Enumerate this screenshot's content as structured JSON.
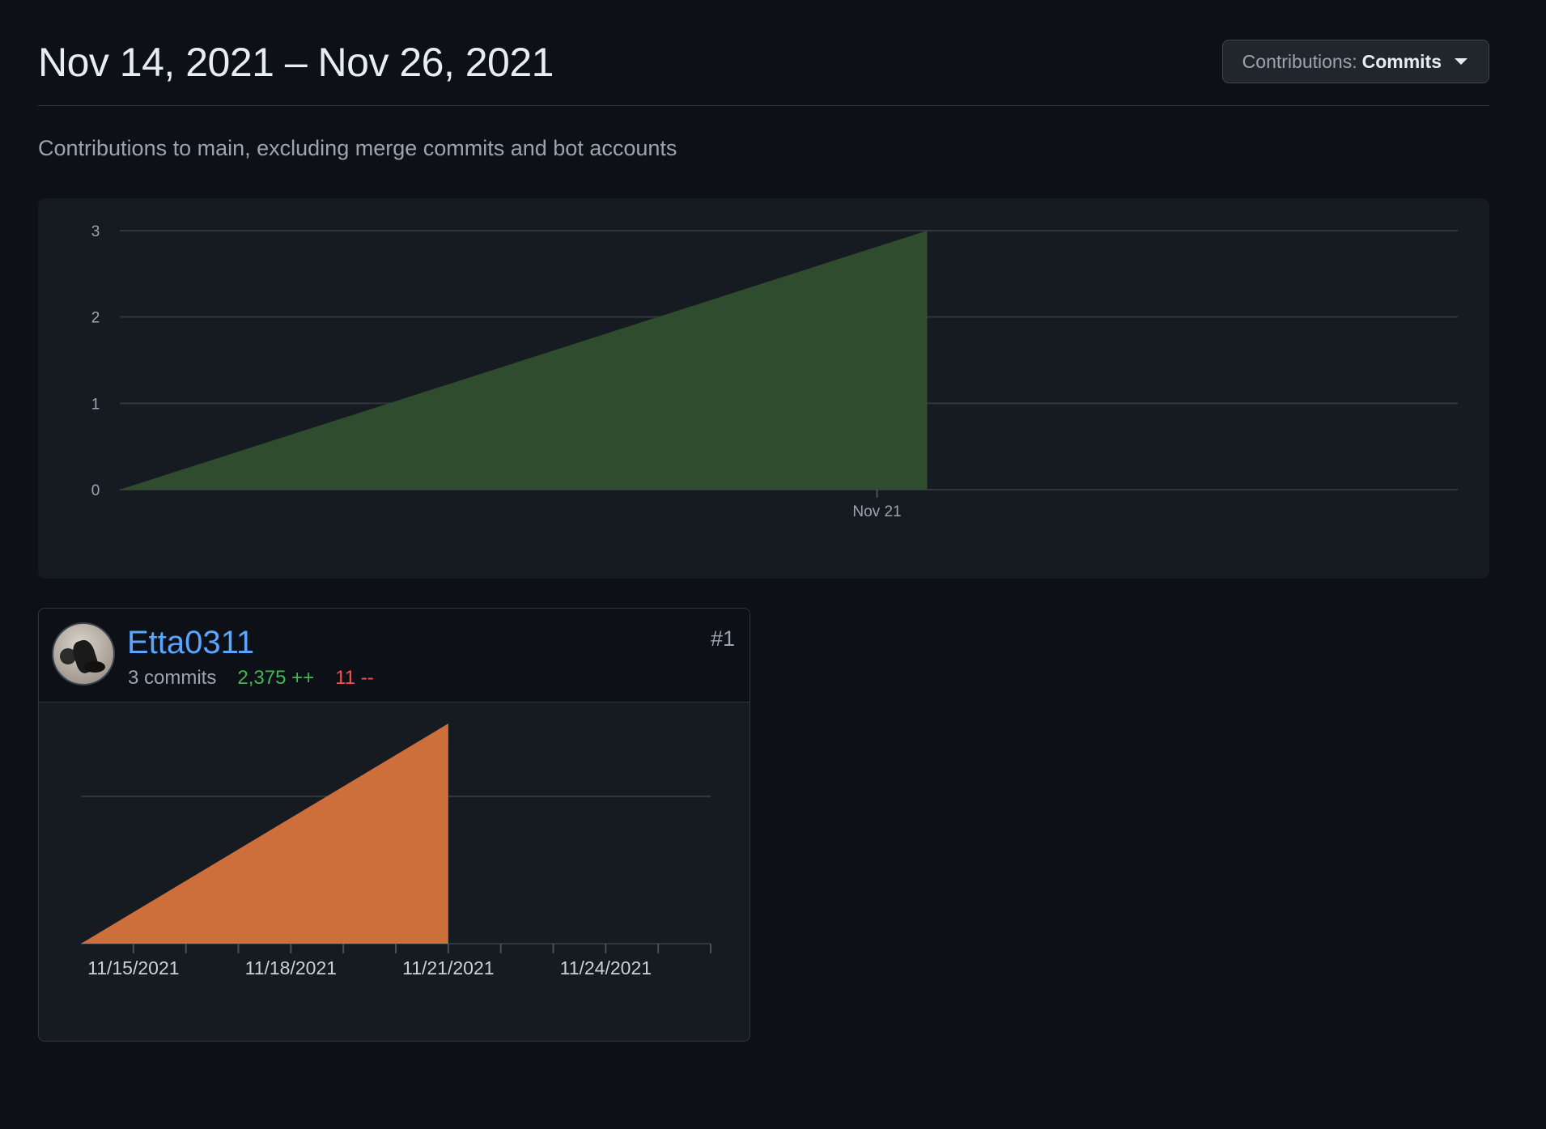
{
  "header": {
    "date_range": "Nov 14, 2021 – Nov 26, 2021",
    "contributions_label": "Contributions:",
    "contributions_value": "Commits"
  },
  "subtitle": "Contributions to main, excluding merge commits and bot accounts",
  "colors": {
    "commits_area": "#2f4d2e",
    "user_area": "#cd6f3a",
    "link": "#58a6ff",
    "additions": "#3fb950",
    "deletions": "#f85149"
  },
  "chart_data": [
    {
      "type": "area",
      "x": [
        "2021-11-14",
        "2021-11-21"
      ],
      "values": [
        0,
        3
      ],
      "x_ticks": [
        "Nov 21"
      ],
      "y_ticks": [
        0,
        1,
        2,
        3
      ],
      "ylim": [
        0,
        3
      ],
      "xlim": [
        "2021-11-14",
        "2021-11-26"
      ],
      "grid": true
    },
    {
      "type": "area",
      "x": [
        "11/14/2021",
        "11/21/2021"
      ],
      "values": [
        0,
        3
      ],
      "x_ticks": [
        "11/15/2021",
        "11/18/2021",
        "11/21/2021",
        "11/24/2021"
      ],
      "xlim": [
        "11/14/2021",
        "11/26/2021"
      ],
      "grid": true
    }
  ],
  "contributor": {
    "username": "Etta0311",
    "commits": "3 commits",
    "additions": "2,375 ++",
    "deletions": "11 --",
    "rank": "#1"
  }
}
